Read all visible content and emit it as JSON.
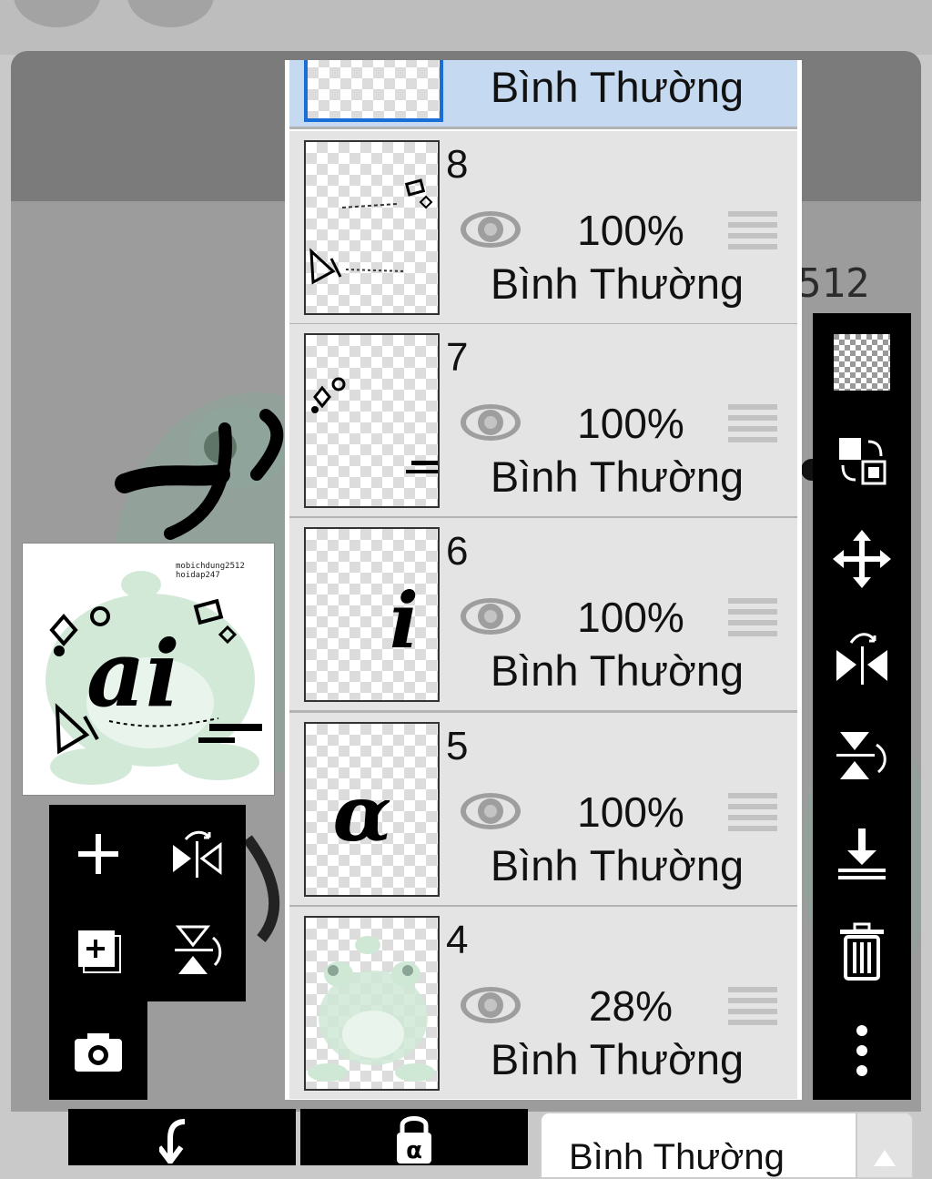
{
  "canvas": {
    "watermark_text": "512"
  },
  "preview": {
    "caption": "mobichdung2512\nhoidap247",
    "art_text": "ai"
  },
  "layers": [
    {
      "number": "",
      "opacity": "",
      "blend": "Bình Thường",
      "active": true
    },
    {
      "number": "8",
      "opacity": "100%",
      "blend": "Bình Thường",
      "active": false
    },
    {
      "number": "7",
      "opacity": "100%",
      "blend": "Bình Thường",
      "active": false
    },
    {
      "number": "6",
      "opacity": "100%",
      "blend": "Bình Thường",
      "active": false
    },
    {
      "number": "5",
      "opacity": "100%",
      "blend": "Bình Thường",
      "active": false
    },
    {
      "number": "4",
      "opacity": "28%",
      "blend": "Bình Thường",
      "active": false
    }
  ],
  "layer_thumbs": {
    "six_glyph": "i",
    "five_glyph": "α"
  },
  "bottom_bar": {
    "blend_mode": "Bình Thường",
    "alpha_lock_glyph": "α"
  },
  "icons": [
    "plus-icon",
    "new-layer-icon",
    "camera-icon",
    "flip-horizontal-icon",
    "flip-vertical-icon",
    "transparent-icon",
    "swap-icon",
    "move-icon",
    "merge-down-icon",
    "trash-icon",
    "more-icon",
    "eye-icon",
    "drag-handle-icon",
    "arrow-return-icon",
    "lock-icon",
    "chevron-up-icon"
  ],
  "colors": {
    "accent_blue": "#1a6fd6",
    "selected_row": "#c5d9f0",
    "panel_black": "#000000"
  }
}
